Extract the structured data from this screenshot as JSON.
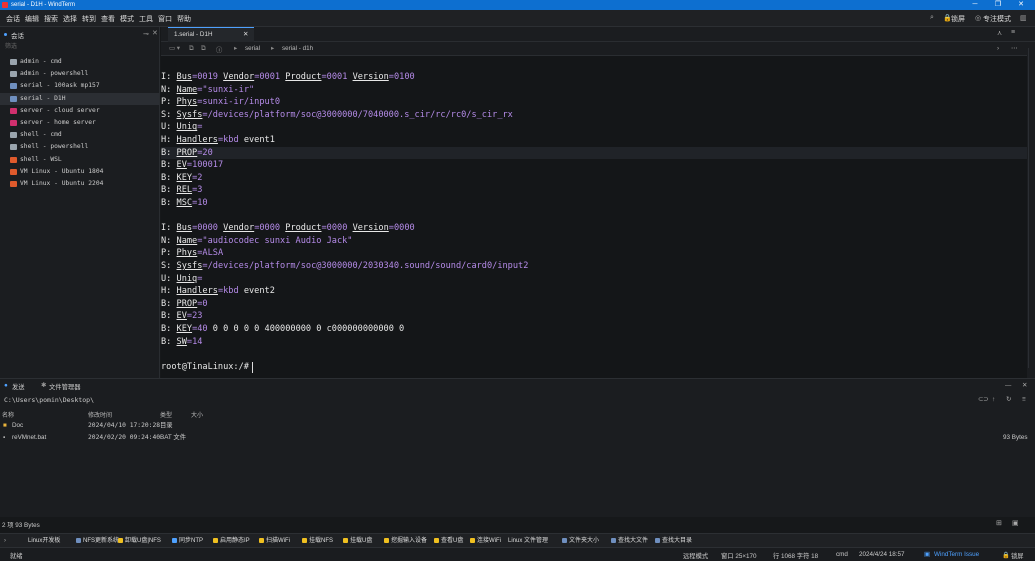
{
  "window": {
    "title": "serial - D1H - WindTerm",
    "minimize": "─",
    "restore": "❐",
    "close": "✕"
  },
  "menu": {
    "items": [
      "会话",
      "编辑",
      "搜索",
      "选择",
      "转到",
      "查看",
      "模式",
      "工具",
      "窗口",
      "帮助"
    ],
    "right": {
      "lock": "锁屏",
      "focus": "专注模式"
    }
  },
  "sidebar": {
    "header": "会话",
    "search_placeholder": "筛选",
    "sessions": [
      {
        "label": "admin - cmd",
        "color": "#9aa4ad"
      },
      {
        "label": "admin - powershell",
        "color": "#9aa4ad"
      },
      {
        "label": "serial - 100ask mp157",
        "color": "#6f8fbf"
      },
      {
        "label": "serial - D1H",
        "color": "#6f8fbf"
      },
      {
        "label": "server - cloud server",
        "color": "#d0306e"
      },
      {
        "label": "server - home server",
        "color": "#d0306e"
      },
      {
        "label": "shell - cmd",
        "color": "#9aa4ad"
      },
      {
        "label": "shell - powershell",
        "color": "#9aa4ad"
      },
      {
        "label": "shell - WSL",
        "color": "#e05a2c"
      },
      {
        "label": "VM Linux - Ubuntu 1804",
        "color": "#e05a2c"
      },
      {
        "label": "VM Linux - Ubuntu 2204",
        "color": "#e05a2c"
      }
    ]
  },
  "terminal": {
    "tab_label": "1.serial - D1H",
    "breadcrumb": [
      "serial",
      "serial - d1h"
    ],
    "lines": [
      "I: Bus=0019 Vendor=0001 Product=0001 Version=0100",
      "N: Name=\"sunxi-ir\"",
      "P: Phys=sunxi-ir/input0",
      "S: Sysfs=/devices/platform/soc@3000000/7040000.s_cir/rc/rc0/s_cir_rx",
      "U: Uniq=",
      "H: Handlers=kbd event1",
      "B: PROP=20",
      "B: EV=100017",
      "B: KEY=2",
      "B: REL=3",
      "B: MSC=10",
      "",
      "I: Bus=0000 Vendor=0000 Product=0000 Version=0000",
      "N: Name=\"audiocodec sunxi Audio Jack\"",
      "P: Phys=ALSA",
      "S: Sysfs=/devices/platform/soc@3000000/2030340.sound/sound/card0/input2",
      "U: Uniq=",
      "H: Handlers=kbd event2",
      "B: PROP=0",
      "B: EV=23",
      "B: KEY=40 0 0 0 0 0 400000000 0 c000000000000 0",
      "B: SW=14",
      "",
      "root@TinaLinux:/# "
    ],
    "highlight_line": 6
  },
  "panel": {
    "tabs": [
      "发送",
      "文件管理器"
    ],
    "path": "C:\\Users\\pomin\\Desktop\\",
    "columns": [
      "名称",
      "修改时间",
      "类型",
      "大小"
    ],
    "files": [
      {
        "name": "Doc",
        "modified": "2024/04/10 17:20:28",
        "type": "目录",
        "size": ""
      },
      {
        "name": "reVMnet.bat",
        "modified": "2024/02/20 09:24:40",
        "type": "BAT 文件",
        "size": "93 Bytes"
      }
    ],
    "status": "2 项 93 Bytes"
  },
  "quick_commands": [
    {
      "label": "Linux开发板",
      "color": ""
    },
    {
      "label": "NFS更新系统",
      "color": "#6f8fbf"
    },
    {
      "label": "卸载U盘|NFS",
      "color": "#f0c020"
    },
    {
      "label": "同步NTP",
      "color": "#4ea1ff"
    },
    {
      "label": "启用静态IP",
      "color": "#f0c020"
    },
    {
      "label": "扫描WiFi",
      "color": "#f0c020"
    },
    {
      "label": "挂载NFS",
      "color": "#f0c020"
    },
    {
      "label": "挂载U盘",
      "color": "#f0c020"
    },
    {
      "label": "挖掘输入设备",
      "color": "#f0c020"
    },
    {
      "label": "查看U盘",
      "color": "#f0c020"
    },
    {
      "label": "连接WiFi",
      "color": "#f0c020"
    },
    {
      "label": "Linux 文件管理",
      "color": ""
    },
    {
      "label": "文件夹大小",
      "color": "#6f8fbf"
    },
    {
      "label": "查找大文件",
      "color": "#6f8fbf"
    },
    {
      "label": "查找大目录",
      "color": "#6f8fbf"
    }
  ],
  "statusbar": {
    "left": "就绪",
    "mode": "远程模式",
    "size": "窗口 25×170",
    "cursor": "行 1068 字符 18",
    "shell": "cmd",
    "datetime": "2024/4/24 18:57",
    "issue": "WindTerm Issue",
    "lock": "锁屏"
  }
}
